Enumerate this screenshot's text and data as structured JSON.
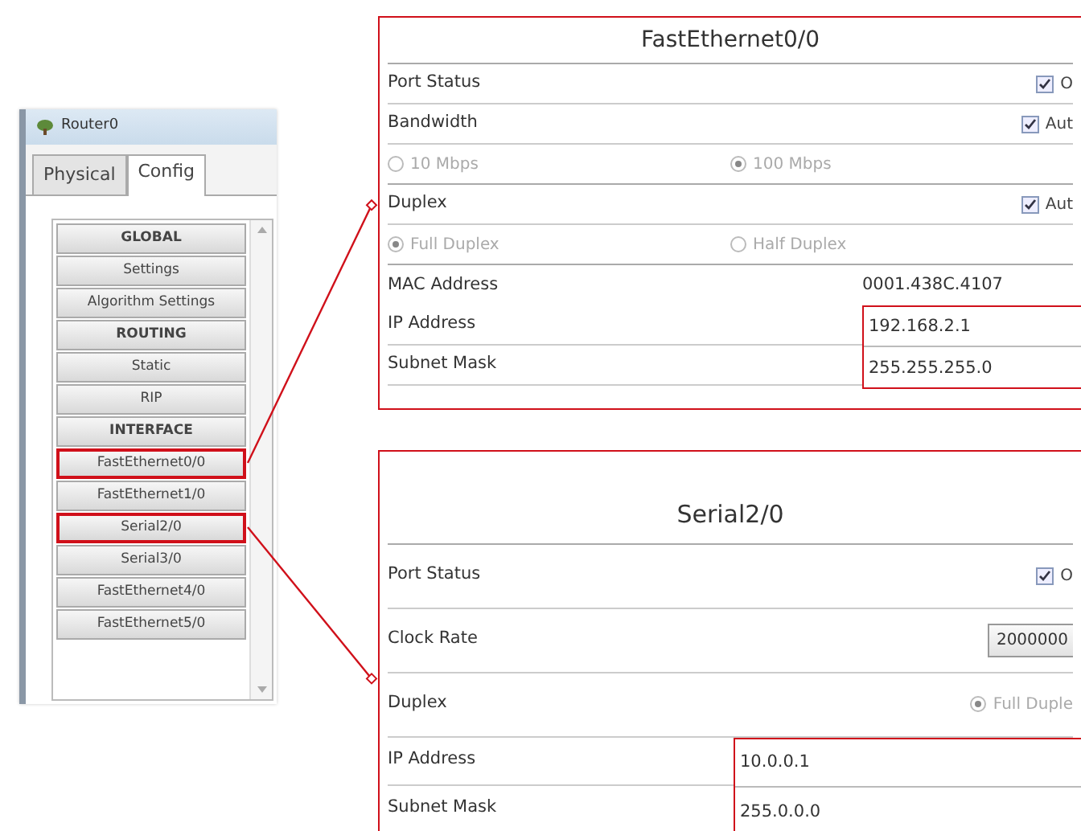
{
  "window": {
    "title": "Router0"
  },
  "tabs": [
    {
      "label": "Physical",
      "selected": false
    },
    {
      "label": "Config",
      "selected": true
    }
  ],
  "config_menu": [
    {
      "label": "GLOBAL",
      "kind": "header",
      "highlighted": false
    },
    {
      "label": "Settings",
      "kind": "item",
      "highlighted": false
    },
    {
      "label": "Algorithm Settings",
      "kind": "item",
      "highlighted": false
    },
    {
      "label": "ROUTING",
      "kind": "header",
      "highlighted": false
    },
    {
      "label": "Static",
      "kind": "item",
      "highlighted": false
    },
    {
      "label": "RIP",
      "kind": "item",
      "highlighted": false
    },
    {
      "label": "INTERFACE",
      "kind": "header",
      "highlighted": false
    },
    {
      "label": "FastEthernet0/0",
      "kind": "item",
      "highlighted": true
    },
    {
      "label": "FastEthernet1/0",
      "kind": "item",
      "highlighted": false
    },
    {
      "label": "Serial2/0",
      "kind": "item",
      "highlighted": true
    },
    {
      "label": "Serial3/0",
      "kind": "item",
      "highlighted": false
    },
    {
      "label": "FastEthernet4/0",
      "kind": "item",
      "highlighted": false
    },
    {
      "label": "FastEthernet5/0",
      "kind": "item",
      "highlighted": false
    }
  ],
  "panels": [
    {
      "title": "FastEthernet0/0",
      "rows": [
        {
          "kind": "check",
          "label": "Port Status",
          "option": "O",
          "checked": true
        },
        {
          "kind": "check",
          "label": "Bandwidth",
          "option": "Aut",
          "checked": true
        },
        {
          "kind": "radios",
          "disabled": true,
          "options": [
            {
              "label": "10 Mbps",
              "selected": false
            },
            {
              "label": "100 Mbps",
              "selected": true
            }
          ]
        },
        {
          "kind": "check",
          "label": "Duplex",
          "option": "Aut",
          "checked": true
        },
        {
          "kind": "radios",
          "disabled": true,
          "options": [
            {
              "label": "Full Duplex",
              "selected": true
            },
            {
              "label": "Half Duplex",
              "selected": false
            }
          ]
        },
        {
          "kind": "value",
          "label": "MAC Address",
          "value": "0001.438C.4107"
        }
      ],
      "fields": {
        "highlighted": true,
        "items": [
          {
            "label": "IP Address",
            "value": "192.168.2.1"
          },
          {
            "label": "Subnet Mask",
            "value": "255.255.255.0"
          }
        ]
      }
    },
    {
      "title": "Serial2/0",
      "rows": [
        {
          "kind": "check",
          "label": "Port Status",
          "option": "O",
          "checked": true
        },
        {
          "kind": "select",
          "label": "Clock Rate",
          "value": "2000000"
        },
        {
          "kind": "radio",
          "label": "Duplex",
          "option": "Full Duple",
          "selected": true,
          "disabled": true
        }
      ],
      "fields": {
        "highlighted": true,
        "items": [
          {
            "label": "IP Address",
            "value": "10.0.0.1"
          },
          {
            "label": "Subnet Mask",
            "value": "255.0.0.0"
          }
        ]
      }
    }
  ]
}
